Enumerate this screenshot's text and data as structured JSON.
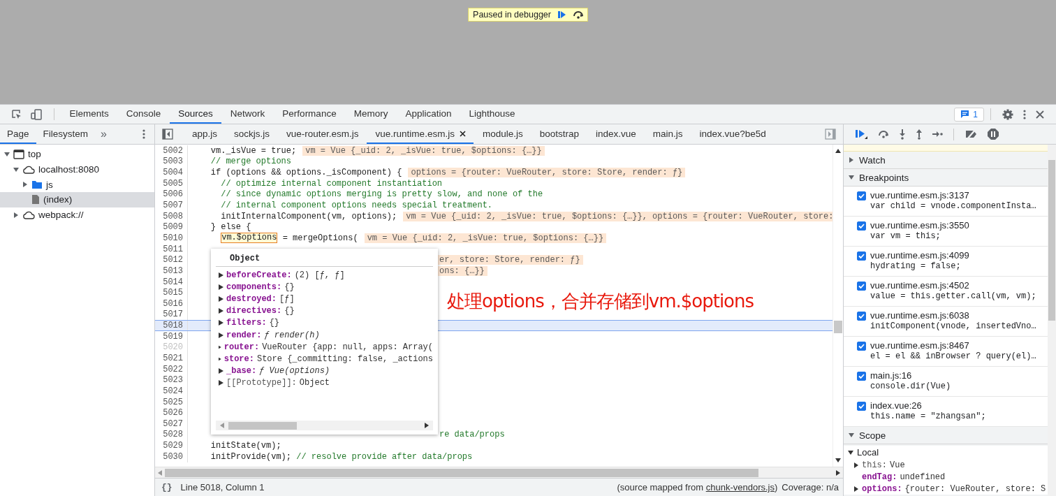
{
  "paused_banner": {
    "label": "Paused in debugger"
  },
  "devtools_tabs": [
    {
      "label": "Elements",
      "selected": false
    },
    {
      "label": "Console",
      "selected": false
    },
    {
      "label": "Sources",
      "selected": true
    },
    {
      "label": "Network",
      "selected": false
    },
    {
      "label": "Performance",
      "selected": false
    },
    {
      "label": "Memory",
      "selected": false
    },
    {
      "label": "Application",
      "selected": false
    },
    {
      "label": "Lighthouse",
      "selected": false
    }
  ],
  "issues_badge": {
    "count": "1"
  },
  "navigator": {
    "tabs": [
      {
        "label": "Page",
        "selected": true
      },
      {
        "label": "Filesystem",
        "selected": false
      }
    ],
    "more": "»",
    "tree": [
      {
        "label": "top",
        "kind": "frame",
        "expanded": true,
        "selected": false,
        "children": [
          {
            "label": "localhost:8080",
            "kind": "origin",
            "expanded": true,
            "selected": false,
            "children": [
              {
                "label": "js",
                "kind": "folder",
                "expanded": false,
                "selected": false
              },
              {
                "label": "(index)",
                "kind": "file",
                "selected": true
              }
            ]
          },
          {
            "label": "webpack://",
            "kind": "origin",
            "expanded": false,
            "selected": false
          }
        ]
      }
    ]
  },
  "editor_tabs": [
    {
      "label": "app.js",
      "selected": false
    },
    {
      "label": "sockjs.js",
      "selected": false
    },
    {
      "label": "vue-router.esm.js",
      "selected": false
    },
    {
      "label": "vue.runtime.esm.js",
      "selected": true
    },
    {
      "label": "module.js",
      "selected": false
    },
    {
      "label": "bootstrap",
      "selected": false
    },
    {
      "label": "index.vue",
      "selected": false
    },
    {
      "label": "main.js",
      "selected": false
    },
    {
      "label": "index.vue?be5d",
      "selected": false
    }
  ],
  "code_lines": [
    {
      "number": "5002",
      "breakable": true,
      "selected": false,
      "code": "    vm._isVue = true;",
      "value": "vm = Vue {_uid: 2, _isVue: true, $options: {…}}"
    },
    {
      "number": "5003",
      "breakable": true,
      "selected": false,
      "comment": "    // merge options"
    },
    {
      "number": "5004",
      "breakable": true,
      "selected": false,
      "code": "    if (options && options._isComponent) {",
      "value": "options = {router: VueRouter, store: Store, render: ƒ}"
    },
    {
      "number": "5005",
      "breakable": true,
      "selected": false,
      "comment": "      // optimize internal component instantiation"
    },
    {
      "number": "5006",
      "breakable": true,
      "selected": false,
      "comment": "      // since dynamic options merging is pretty slow, and none of the"
    },
    {
      "number": "5007",
      "breakable": true,
      "selected": false,
      "comment": "      // internal component options needs special treatment."
    },
    {
      "number": "5008",
      "breakable": true,
      "selected": false,
      "code": "      initInternalComponent(vm, options);",
      "value": "vm = Vue {_uid: 2, _isVue: true, $options: {…}}, options = {router: VueRouter, store:"
    },
    {
      "number": "5009",
      "breakable": true,
      "selected": false,
      "code": "    } else {"
    },
    {
      "number": "5010",
      "breakable": true,
      "selected": false,
      "hover": "      vm.$options",
      "code": " = mergeOptions(",
      "value": "vm = Vue {_uid: 2, _isVue: true, $options: {…}}"
    },
    {
      "number": "5011",
      "breakable": true,
      "selected": false
    },
    {
      "number": "5012",
      "breakable": true,
      "selected": false,
      "tail_value": "er, store: Store, render: ƒ}"
    },
    {
      "number": "5013",
      "breakable": true,
      "selected": false,
      "tail_value": "ons: {…}}"
    },
    {
      "number": "5014",
      "breakable": true,
      "selected": false
    },
    {
      "number": "5015",
      "breakable": true,
      "selected": false
    },
    {
      "number": "5016",
      "breakable": true,
      "selected": false
    },
    {
      "number": "5017",
      "breakable": true,
      "selected": false
    },
    {
      "number": "5018",
      "breakable": true,
      "selected": true
    },
    {
      "number": "5019",
      "breakable": true,
      "selected": false
    },
    {
      "number": "5020",
      "breakable": false,
      "selected": false
    },
    {
      "number": "5021",
      "breakable": true,
      "selected": false
    },
    {
      "number": "5022",
      "breakable": true,
      "selected": false
    },
    {
      "number": "5023",
      "breakable": true,
      "selected": false
    },
    {
      "number": "5024",
      "breakable": true,
      "selected": false
    },
    {
      "number": "5025",
      "breakable": true,
      "selected": false
    },
    {
      "number": "5026",
      "breakable": true,
      "selected": false
    },
    {
      "number": "5027",
      "breakable": true,
      "selected": false
    },
    {
      "number": "5028",
      "breakable": true,
      "selected": false,
      "tail_comment": "re data/props"
    },
    {
      "number": "5029",
      "breakable": true,
      "selected": false,
      "code": "    initState(vm);"
    },
    {
      "number": "5030",
      "breakable": true,
      "selected": false,
      "code": "    initProvide(vm);",
      "comment": " // resolve provide after data/props"
    }
  ],
  "popover": {
    "title": "Object",
    "properties": [
      {
        "name": "beforeCreate:",
        "value": "(2) [ƒ, ƒ]",
        "kind": "object"
      },
      {
        "name": "components:",
        "value": "{}",
        "kind": "object"
      },
      {
        "name": "destroyed:",
        "value": "[ƒ]",
        "kind": "object"
      },
      {
        "name": "directives:",
        "value": "{}",
        "kind": "object"
      },
      {
        "name": "filters:",
        "value": "{}",
        "kind": "object"
      },
      {
        "name": "render:",
        "value": "ƒ render(h)",
        "kind": "function"
      },
      {
        "name": "router:",
        "value": "VueRouter {app: null, apps: Array(",
        "kind": "object"
      },
      {
        "name": "store:",
        "value": "Store {_committing: false, _actions",
        "kind": "object"
      },
      {
        "name": "_base:",
        "value": "ƒ Vue(options)",
        "kind": "function"
      },
      {
        "name": "[[Prototype]]:",
        "value": "Object",
        "kind": "internal"
      }
    ]
  },
  "annotation": {
    "text": "处理options，合并存储到vm.$options"
  },
  "status_bar": {
    "format_button": "{}",
    "position": "Line 5018, Column 1",
    "source_prefix": "(source mapped from ",
    "source_link": "chunk-vendors.js",
    "source_suffix": ")",
    "coverage": "Coverage: n/a"
  },
  "debugger": {
    "watch": {
      "title": "Watch",
      "expanded": false
    },
    "breakpoints": {
      "title": "Breakpoints",
      "expanded": true,
      "items": [
        {
          "location": "vue.runtime.esm.js:3137",
          "code": "var child = vnode.componentInsta…",
          "checked": true
        },
        {
          "location": "vue.runtime.esm.js:3550",
          "code": "var vm = this;",
          "checked": true
        },
        {
          "location": "vue.runtime.esm.js:4099",
          "code": "hydrating = false;",
          "checked": true
        },
        {
          "location": "vue.runtime.esm.js:4502",
          "code": "value = this.getter.call(vm, vm);",
          "checked": true
        },
        {
          "location": "vue.runtime.esm.js:6038",
          "code": "initComponent(vnode, insertedVno…",
          "checked": true
        },
        {
          "location": "vue.runtime.esm.js:8467",
          "code": "el = el && inBrowser ? query(el)…",
          "checked": true
        },
        {
          "location": "main.js:16",
          "code": "console.dir(Vue)",
          "checked": true
        },
        {
          "location": "index.vue:26",
          "code": "this.name = \"zhangsan\";",
          "checked": true
        }
      ]
    },
    "scope": {
      "title": "Scope",
      "expanded": true,
      "groups": [
        {
          "title": "Local",
          "expanded": true,
          "vars": [
            {
              "name": "this:",
              "value": "Vue",
              "expandable": true
            },
            {
              "name": "endTag:",
              "value": "undefined",
              "expandable": false
            },
            {
              "name": "options:",
              "value": "{router: VueRouter, store: S",
              "expandable": true
            }
          ]
        }
      ]
    }
  }
}
